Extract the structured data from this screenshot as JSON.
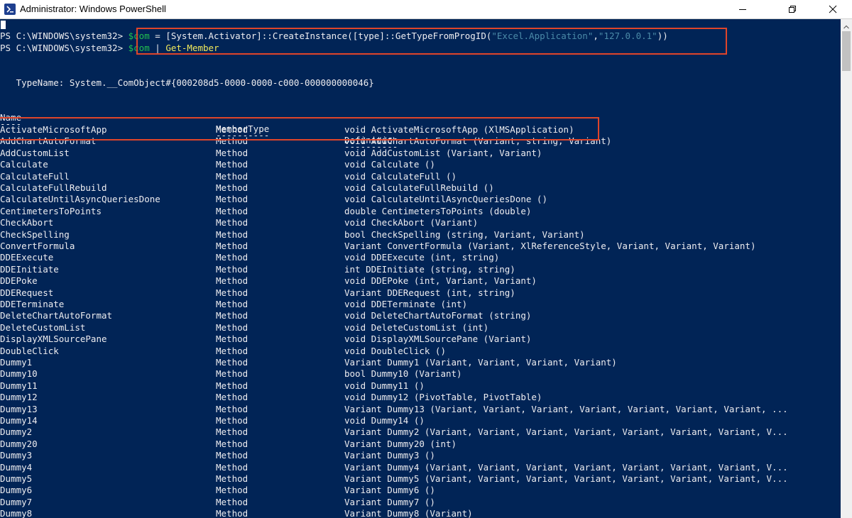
{
  "window": {
    "title": "Administrator: Windows PowerShell",
    "icon": "powershell-icon",
    "controls": [
      "minimize-icon",
      "maximize-icon",
      "close-icon"
    ]
  },
  "colors": {
    "console_bg": "#012456",
    "console_fg": "#eeedf0",
    "variable": "#22c04f",
    "string": "#4b8aa8",
    "command": "#f1e95b",
    "highlight_box": "#e0452a"
  },
  "console": {
    "prompt1": "PS C:\\WINDOWS\\system32> ",
    "cmd1_var": "$com",
    "cmd1_mid": " = [System.Activator]::CreateInstance([type]::GetTypeFromProgID(",
    "cmd1_str1": "\"Excel.Application\"",
    "cmd1_comma": ",",
    "cmd1_str2": "\"127.0.0.1\"",
    "cmd1_end": "))",
    "prompt2": "PS C:\\WINDOWS\\system32> ",
    "cmd2_var": "$com",
    "cmd2_pipe": " | ",
    "cmd2_cmd": "Get-Member",
    "typename": "   TypeName: System.__ComObject#{000208d5-0000-0000-c000-000000000046}",
    "headers": {
      "name": "Name",
      "membertype": "MemberType",
      "definition": "Definition"
    },
    "underlines": {
      "name": "----",
      "membertype": "----------",
      "definition": "----------"
    },
    "rows": [
      {
        "name": "ActivateMicrosoftApp",
        "type": "Method",
        "def": "void ActivateMicrosoftApp (XlMSApplication)"
      },
      {
        "name": "AddChartAutoFormat",
        "type": "Method",
        "def": "void AddChartAutoFormat (Variant, string, Variant)"
      },
      {
        "name": "AddCustomList",
        "type": "Method",
        "def": "void AddCustomList (Variant, Variant)"
      },
      {
        "name": "Calculate",
        "type": "Method",
        "def": "void Calculate ()"
      },
      {
        "name": "CalculateFull",
        "type": "Method",
        "def": "void CalculateFull ()"
      },
      {
        "name": "CalculateFullRebuild",
        "type": "Method",
        "def": "void CalculateFullRebuild ()"
      },
      {
        "name": "CalculateUntilAsyncQueriesDone",
        "type": "Method",
        "def": "void CalculateUntilAsyncQueriesDone ()"
      },
      {
        "name": "CentimetersToPoints",
        "type": "Method",
        "def": "double CentimetersToPoints (double)"
      },
      {
        "name": "CheckAbort",
        "type": "Method",
        "def": "void CheckAbort (Variant)"
      },
      {
        "name": "CheckSpelling",
        "type": "Method",
        "def": "bool CheckSpelling (string, Variant, Variant)"
      },
      {
        "name": "ConvertFormula",
        "type": "Method",
        "def": "Variant ConvertFormula (Variant, XlReferenceStyle, Variant, Variant, Variant)"
      },
      {
        "name": "DDEExecute",
        "type": "Method",
        "def": "void DDEExecute (int, string)"
      },
      {
        "name": "DDEInitiate",
        "type": "Method",
        "def": "int DDEInitiate (string, string)"
      },
      {
        "name": "DDEPoke",
        "type": "Method",
        "def": "void DDEPoke (int, Variant, Variant)"
      },
      {
        "name": "DDERequest",
        "type": "Method",
        "def": "Variant DDERequest (int, string)"
      },
      {
        "name": "DDETerminate",
        "type": "Method",
        "def": "void DDETerminate (int)"
      },
      {
        "name": "DeleteChartAutoFormat",
        "type": "Method",
        "def": "void DeleteChartAutoFormat (string)"
      },
      {
        "name": "DeleteCustomList",
        "type": "Method",
        "def": "void DeleteCustomList (int)"
      },
      {
        "name": "DisplayXMLSourcePane",
        "type": "Method",
        "def": "void DisplayXMLSourcePane (Variant)"
      },
      {
        "name": "DoubleClick",
        "type": "Method",
        "def": "void DoubleClick ()"
      },
      {
        "name": "Dummy1",
        "type": "Method",
        "def": "Variant Dummy1 (Variant, Variant, Variant, Variant)"
      },
      {
        "name": "Dummy10",
        "type": "Method",
        "def": "bool Dummy10 (Variant)"
      },
      {
        "name": "Dummy11",
        "type": "Method",
        "def": "void Dummy11 ()"
      },
      {
        "name": "Dummy12",
        "type": "Method",
        "def": "void Dummy12 (PivotTable, PivotTable)"
      },
      {
        "name": "Dummy13",
        "type": "Method",
        "def": "Variant Dummy13 (Variant, Variant, Variant, Variant, Variant, Variant, Variant, ..."
      },
      {
        "name": "Dummy14",
        "type": "Method",
        "def": "void Dummy14 ()"
      },
      {
        "name": "Dummy2",
        "type": "Method",
        "def": "Variant Dummy2 (Variant, Variant, Variant, Variant, Variant, Variant, Variant, V..."
      },
      {
        "name": "Dummy20",
        "type": "Method",
        "def": "Variant Dummy20 (int)"
      },
      {
        "name": "Dummy3",
        "type": "Method",
        "def": "Variant Dummy3 ()"
      },
      {
        "name": "Dummy4",
        "type": "Method",
        "def": "Variant Dummy4 (Variant, Variant, Variant, Variant, Variant, Variant, Variant, V..."
      },
      {
        "name": "Dummy5",
        "type": "Method",
        "def": "Variant Dummy5 (Variant, Variant, Variant, Variant, Variant, Variant, Variant, V..."
      },
      {
        "name": "Dummy6",
        "type": "Method",
        "def": "Variant Dummy6 ()"
      },
      {
        "name": "Dummy7",
        "type": "Method",
        "def": "Variant Dummy7 ()"
      },
      {
        "name": "Dummy8",
        "type": "Method",
        "def": "Variant Dummy8 (Variant)"
      }
    ]
  }
}
